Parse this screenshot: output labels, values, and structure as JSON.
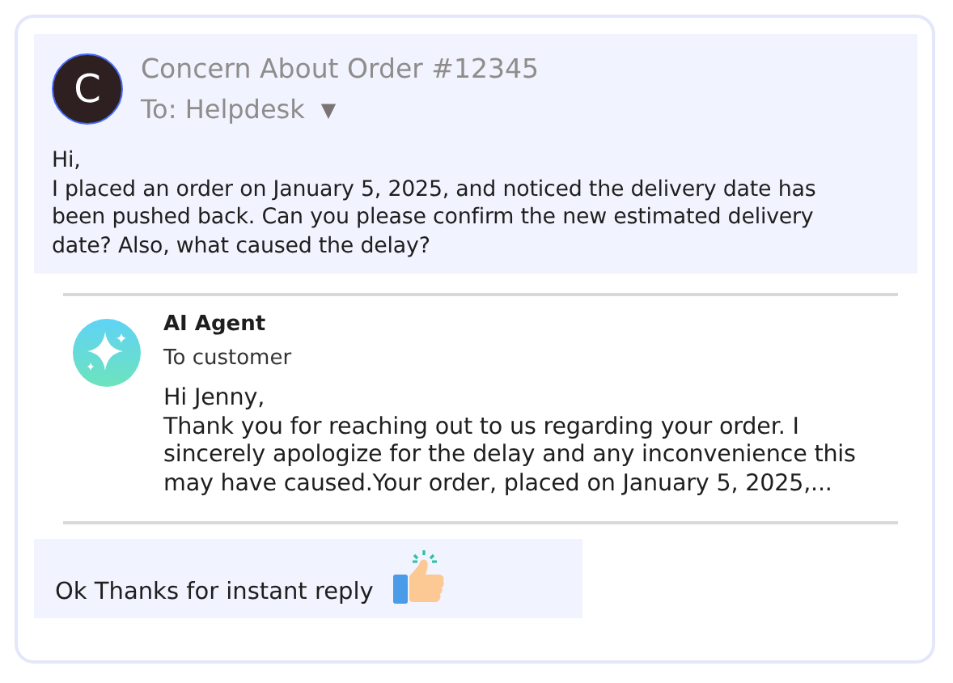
{
  "ticket": {
    "avatar_letter": "C",
    "subject": "Concern About Order #12345",
    "recipient": "To: Helpdesk",
    "dropdown_glyph": "▼",
    "message_lines": [
      "Hi,",
      "I placed an order on January 5, 2025, and noticed the delivery date has",
      "been pushed back. Can you please confirm the new estimated delivery",
      "date? Also, what caused the delay?"
    ]
  },
  "agent_reply": {
    "sender": "AI Agent",
    "recipient": "To customer",
    "message_lines": [
      "Hi Jenny,",
      "Thank you for reaching out to us regarding your order. I",
      "sincerely apologize for the delay and any inconvenience this",
      "may have caused.Your order, placed on January 5, 2025,..."
    ]
  },
  "customer_reply": {
    "text": "Ok Thanks for instant reply"
  }
}
